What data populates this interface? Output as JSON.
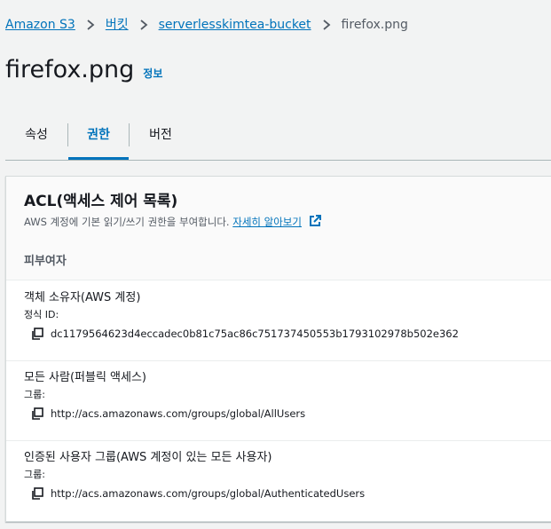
{
  "breadcrumb": {
    "items": [
      "Amazon S3",
      "버킷",
      "serverlesskimtea-bucket"
    ],
    "current": "firefox.png"
  },
  "page": {
    "title": "firefox.png",
    "info_link": "정보"
  },
  "tabs": [
    {
      "label": "속성"
    },
    {
      "label": "권한",
      "active": true
    },
    {
      "label": "버전"
    }
  ],
  "acl": {
    "title": "ACL(액세스 제어 목록)",
    "description": "AWS 계정에 기본 읽기/쓰기 권한을 부여합니다.",
    "learn_more": "자세히 알아보기",
    "column_header": "피부여자",
    "grantees": [
      {
        "name": "객체 소유자(AWS 계정)",
        "label": "정식 ID:",
        "value": "dc1179564623d4eccadec0b81c75ac86c751737450553b1793102978b502e362"
      },
      {
        "name": "모든 사람(퍼블릭 액세스)",
        "label": "그룹:",
        "value": "http://acs.amazonaws.com/groups/global/AllUsers"
      },
      {
        "name": "인증된 사용자 그룹(AWS 계정이 있는 모든 사용자)",
        "label": "그룹:",
        "value": "http://acs.amazonaws.com/groups/global/AuthenticatedUsers"
      }
    ]
  },
  "colors": {
    "link": "#0073bb",
    "text": "#16191f",
    "muted": "#545b64",
    "background": "#f2f3f3"
  }
}
